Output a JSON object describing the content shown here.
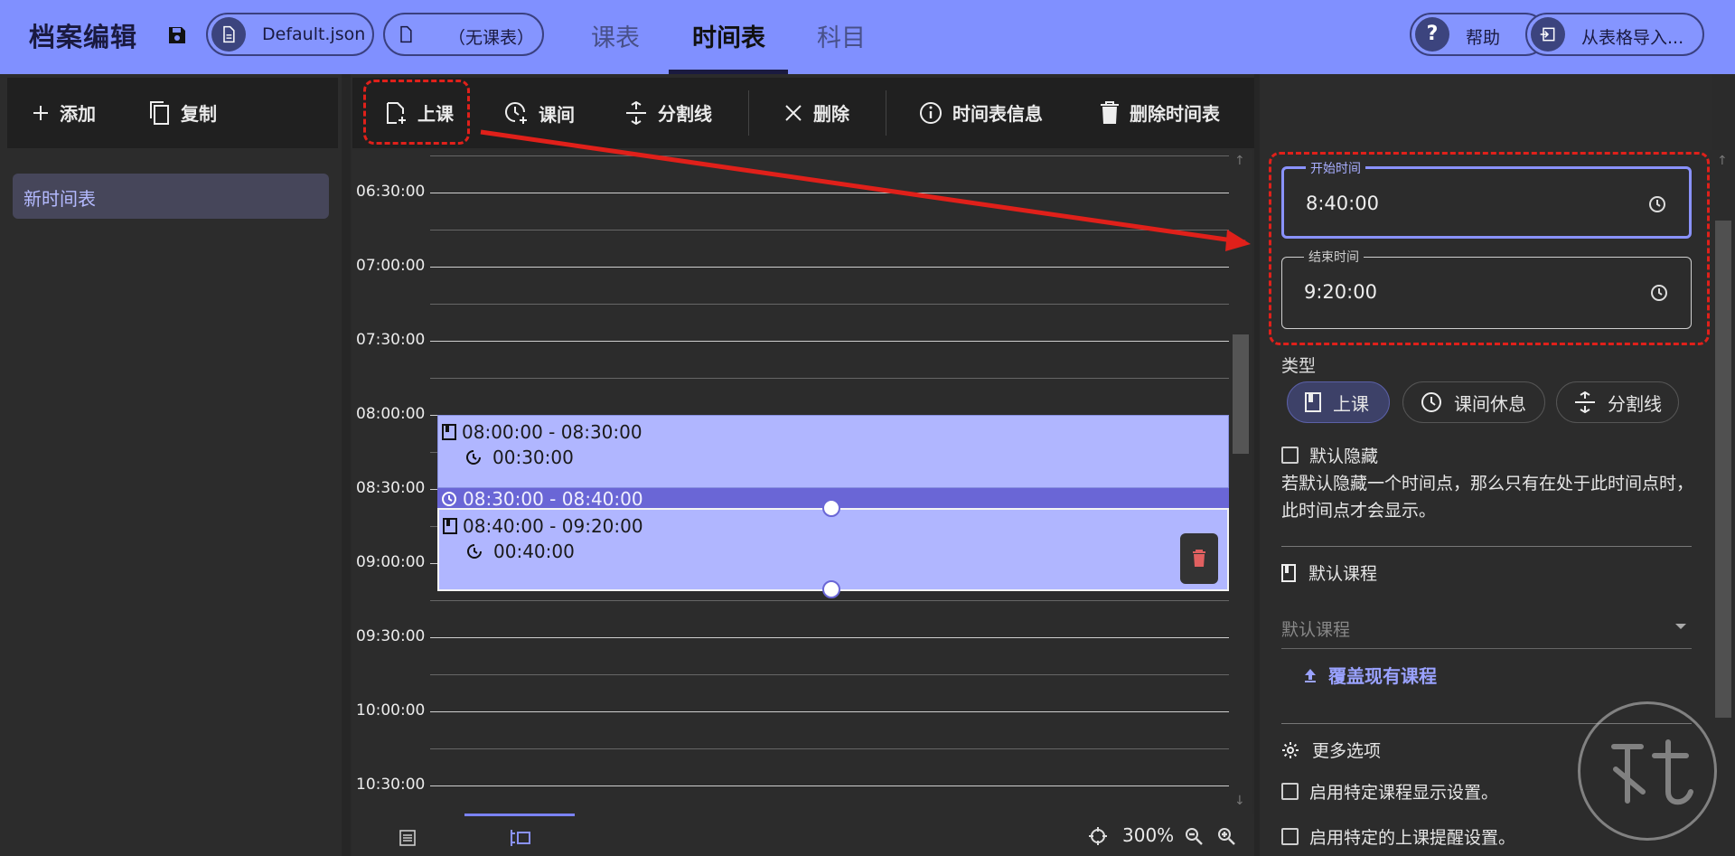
{
  "header": {
    "title": "档案编辑",
    "file_pill": "Default.json",
    "class_pill": "（无课表）",
    "tabs": [
      "课表",
      "时间表",
      "科目"
    ],
    "active_tab": "时间表",
    "help_label": "帮助",
    "import_label": "从表格导入..."
  },
  "left": {
    "add_label": "添加",
    "copy_label": "复制",
    "items": [
      {
        "label": "新时间表",
        "selected": true
      }
    ]
  },
  "timeline_toolbar": {
    "lesson_label": "上课",
    "break_label": "课间",
    "divider_label": "分割线",
    "delete_label": "删除",
    "info_label": "时间表信息",
    "delete_timetable_label": "删除时间表"
  },
  "timeline": {
    "labels": [
      "06:30:00",
      "07:00:00",
      "07:30:00",
      "08:00:00",
      "08:30:00",
      "09:00:00",
      "09:30:00",
      "10:00:00",
      "10:30:00"
    ],
    "blocks": [
      {
        "type": "lesson",
        "range": "08:00:00 - 08:30:00",
        "duration": "00:30:00"
      },
      {
        "type": "break",
        "range": "08:30:00 - 08:40:00"
      },
      {
        "type": "lesson",
        "range": "08:40:00 - 09:20:00",
        "duration": "00:40:00",
        "selected": true
      }
    ]
  },
  "bottom": {
    "zoom": "300%"
  },
  "detail": {
    "start_label": "开始时间",
    "start_value": "8:40:00",
    "end_label": "结束时间",
    "end_value": "9:20:00",
    "type_label": "类型",
    "types": [
      "上课",
      "课间休息",
      "分割线"
    ],
    "selected_type": "上课",
    "default_hidden_label": "默认隐藏",
    "default_hidden_desc": "若默认隐藏一个时间点，那么只有在处于此时间点时，此时间点才会显示。",
    "default_course_title": "默认课程",
    "default_course_placeholder": "默认课程",
    "override_label": "覆盖现有课程",
    "more_options_label": "更多选项",
    "option1_label": "启用特定课程显示设置。",
    "option2_label": "启用特定的上课提醒设置。"
  },
  "colors": {
    "header_bg": "#8090ff",
    "accent": "#8a92ff",
    "lesson_block": "#b0b6ff",
    "break_block": "#6a66d6",
    "annotation_red": "#e0201a"
  }
}
